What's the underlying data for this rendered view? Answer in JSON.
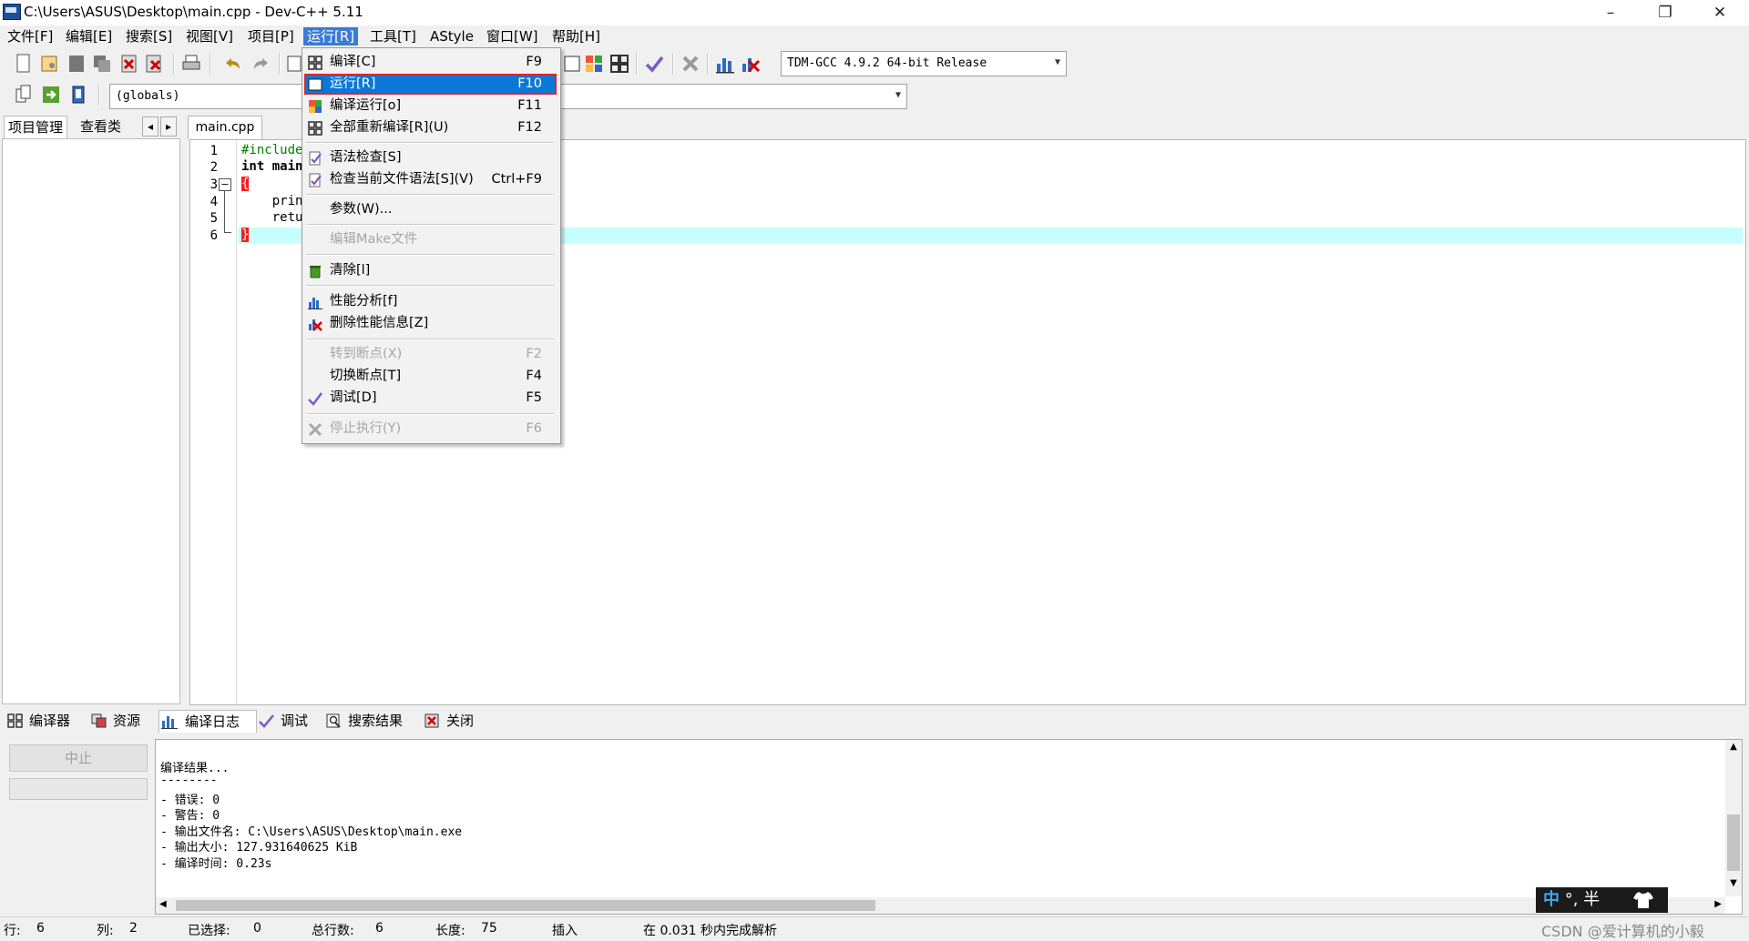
{
  "window": {
    "title": "C:\\Users\\ASUS\\Desktop\\main.cpp - Dev-C++ 5.11",
    "minimize": "–",
    "restore": "❐",
    "close": "✕"
  },
  "menubar": {
    "items": [
      {
        "label": "文件[F]"
      },
      {
        "label": "编辑[E]"
      },
      {
        "label": "搜索[S]"
      },
      {
        "label": "视图[V]"
      },
      {
        "label": "项目[P]"
      },
      {
        "label": "运行[R]"
      },
      {
        "label": "工具[T]"
      },
      {
        "label": "AStyle"
      },
      {
        "label": "窗口[W]"
      },
      {
        "label": "帮助[H]"
      }
    ]
  },
  "toolbar": {
    "compiler_select": "TDM-GCC 4.9.2 64-bit Release",
    "scope_select": "(globals)"
  },
  "left_panel": {
    "tabs": [
      "项目管理",
      "查看类"
    ],
    "nav_prev": "◂",
    "nav_next": "▸"
  },
  "editor": {
    "file_tab": "main.cpp",
    "line_numbers": [
      "1",
      "2",
      "3",
      "4",
      "5",
      "6"
    ],
    "lines": [
      "#include",
      "int main",
      "{",
      "    prin",
      "    retu",
      "}"
    ]
  },
  "run_menu": {
    "items": [
      {
        "label": "编译[C]",
        "shortcut": "F9"
      },
      {
        "label": "运行[R]",
        "shortcut": "F10"
      },
      {
        "label": "编译运行[o]",
        "shortcut": "F11"
      },
      {
        "label": "全部重新编译[R](U)",
        "shortcut": "F12"
      },
      {
        "label": "语法检查[S]",
        "shortcut": ""
      },
      {
        "label": "检查当前文件语法[S](V)",
        "shortcut": "Ctrl+F9"
      },
      {
        "label": "参数(W)...",
        "shortcut": ""
      },
      {
        "label": "编辑Make文件",
        "shortcut": ""
      },
      {
        "label": "清除[l]",
        "shortcut": ""
      },
      {
        "label": "性能分析[f]",
        "shortcut": ""
      },
      {
        "label": "删除性能信息[Z]",
        "shortcut": ""
      },
      {
        "label": "转到断点(X)",
        "shortcut": "F2"
      },
      {
        "label": "切换断点[T]",
        "shortcut": "F4"
      },
      {
        "label": "调试[D]",
        "shortcut": "F5"
      },
      {
        "label": "停止执行(Y)",
        "shortcut": "F6"
      }
    ]
  },
  "bottom_tabs": [
    "编译器",
    "资源",
    "编译日志",
    "调试",
    "搜索结果",
    "关闭"
  ],
  "bottom_left": {
    "abort_button": "中止"
  },
  "compile_log": [
    "编译结果...",
    "--------",
    "- 错误: 0",
    "- 警告: 0",
    "- 输出文件名: C:\\Users\\ASUS\\Desktop\\main.exe",
    "- 输出大小: 127.931640625 KiB",
    "- 编译时间: 0.23s"
  ],
  "statusbar": {
    "row_label": "行:",
    "row_value": "6",
    "col_label": "列:",
    "col_value": "2",
    "sel_label": "已选择:",
    "sel_value": "0",
    "total_label": "总行数:",
    "total_value": "6",
    "len_label": "长度:",
    "len_value": "75",
    "mode": "插入",
    "parse_info": "在 0.031 秒内完成解析"
  },
  "ime": {
    "text": "中 °, 半"
  },
  "watermark": "CSDN @爱计算机的小毅",
  "colors": {
    "menu_active": "#3a7bd5",
    "menu_highlight": "#0a78d7",
    "highlight_outline": "#e8202a",
    "current_line": "#c6ffff"
  }
}
